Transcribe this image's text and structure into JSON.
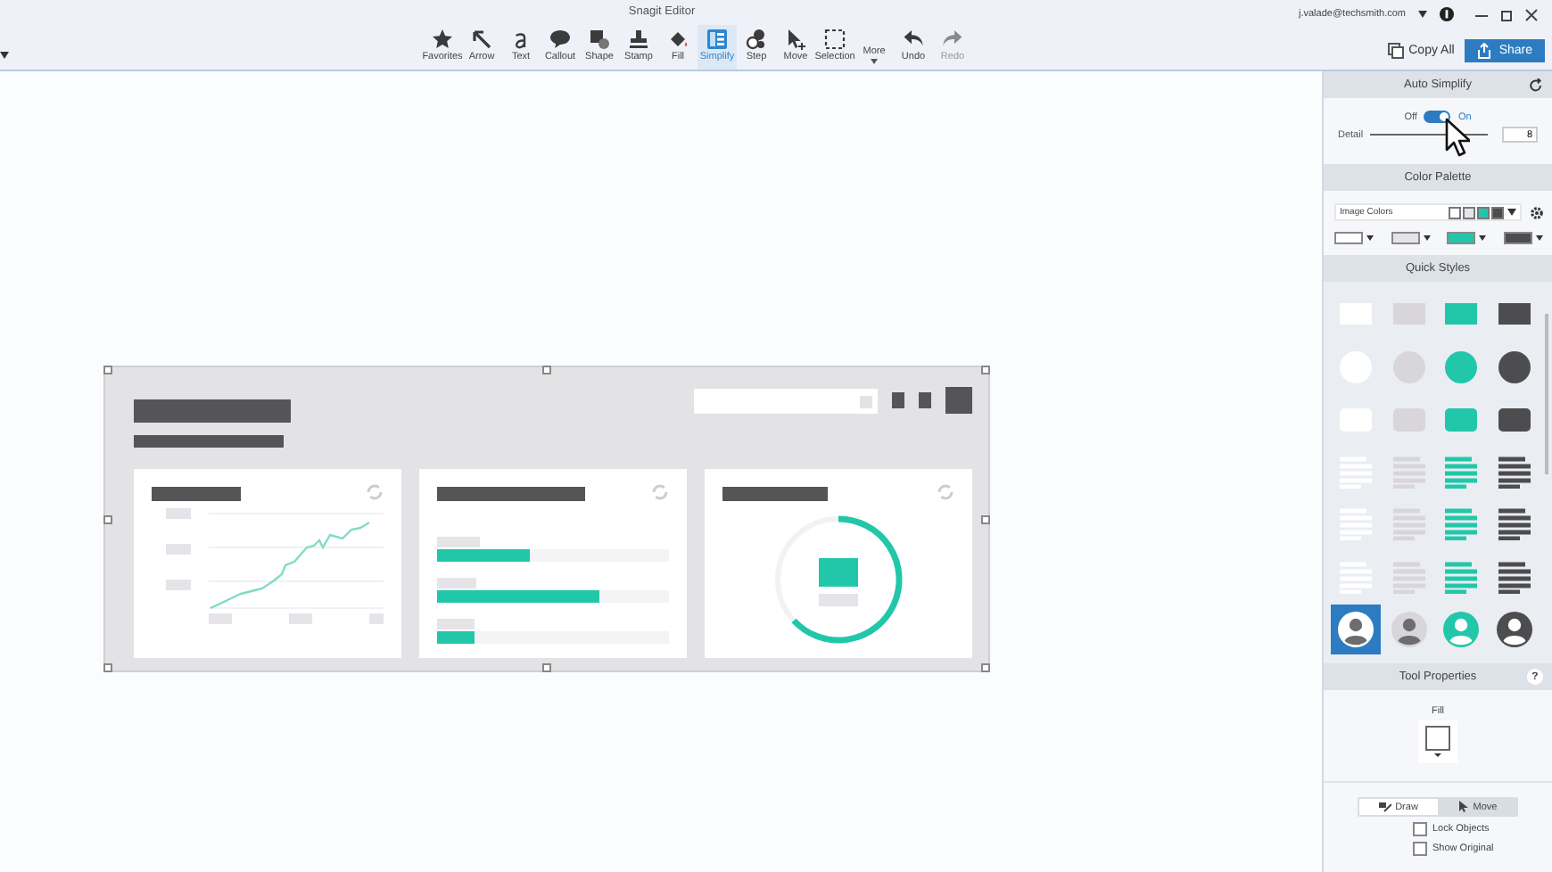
{
  "window": {
    "title": "Snagit Editor",
    "account": "j.valade@techsmith.com"
  },
  "toolbar": [
    {
      "label": "Favorites",
      "kind": "star",
      "selected": false,
      "disabled": false
    },
    {
      "label": "Arrow",
      "kind": "arrow",
      "selected": false,
      "disabled": false
    },
    {
      "label": "Text",
      "kind": "text",
      "selected": false,
      "disabled": false
    },
    {
      "label": "Callout",
      "kind": "callout",
      "selected": false,
      "disabled": false
    },
    {
      "label": "Shape",
      "kind": "shape",
      "selected": false,
      "disabled": false
    },
    {
      "label": "Stamp",
      "kind": "stamp",
      "selected": false,
      "disabled": false
    },
    {
      "label": "Fill",
      "kind": "fill",
      "selected": false,
      "disabled": false
    },
    {
      "label": "Simplify",
      "kind": "simplify",
      "selected": true,
      "disabled": false
    },
    {
      "label": "Step",
      "kind": "step",
      "selected": false,
      "disabled": false
    },
    {
      "label": "Move",
      "kind": "move",
      "selected": false,
      "disabled": false
    },
    {
      "label": "Selection",
      "kind": "selection",
      "selected": false,
      "disabled": false
    },
    {
      "label": "More",
      "kind": "more",
      "selected": false,
      "disabled": false
    },
    {
      "label": "Undo",
      "kind": "undo",
      "selected": false,
      "disabled": false
    },
    {
      "label": "Redo",
      "kind": "redo",
      "selected": false,
      "disabled": true
    }
  ],
  "actions": {
    "copy_all": "Copy All",
    "share": "Share"
  },
  "auto_simplify": {
    "title": "Auto Simplify",
    "off_label": "Off",
    "on_label": "On",
    "on": true,
    "detail_label": "Detail",
    "detail_value": "8"
  },
  "color_palette": {
    "title": "Color Palette",
    "palette": "Image Colors",
    "swatches": [
      {
        "color": "#ffffff"
      },
      {
        "color": "#e6e4e8"
      },
      {
        "color": "#22c7a9"
      },
      {
        "color": "#4d4d50"
      }
    ],
    "colors": [
      {
        "color": "#ffffff"
      },
      {
        "color": "#e6e4e8"
      },
      {
        "color": "#22c7a9"
      },
      {
        "color": "#4d4d50"
      }
    ]
  },
  "quick_styles": {
    "title": "Quick Styles",
    "rows": [
      {
        "kind": "rect",
        "items": [
          {
            "color": "#ffffff",
            "selected": false
          },
          {
            "color": "#d8d6db",
            "selected": false
          },
          {
            "color": "#22c7a9",
            "selected": false
          },
          {
            "color": "#4d4d50",
            "selected": false
          }
        ]
      },
      {
        "kind": "circle",
        "items": [
          {
            "color": "#ffffff",
            "selected": false
          },
          {
            "color": "#d8d6db",
            "selected": false
          },
          {
            "color": "#22c7a9",
            "selected": false
          },
          {
            "color": "#4d4d50",
            "selected": false
          }
        ]
      },
      {
        "kind": "rounded",
        "items": [
          {
            "color": "#ffffff",
            "selected": false
          },
          {
            "color": "#d8d6db",
            "selected": false
          },
          {
            "color": "#22c7a9",
            "selected": false
          },
          {
            "color": "#4d4d50",
            "selected": false
          }
        ]
      },
      {
        "kind": "lines",
        "items": [
          {
            "color": "#ffffff",
            "selected": false
          },
          {
            "color": "#d8d6db",
            "selected": false
          },
          {
            "color": "#22c7a9",
            "selected": false
          },
          {
            "color": "#4d4d50",
            "selected": false
          }
        ]
      },
      {
        "kind": "lines",
        "items": [
          {
            "color": "#ffffff",
            "selected": false
          },
          {
            "color": "#d8d6db",
            "selected": false
          },
          {
            "color": "#22c7a9",
            "selected": false
          },
          {
            "color": "#4d4d50",
            "selected": false
          }
        ]
      },
      {
        "kind": "lines",
        "items": [
          {
            "color": "#ffffff",
            "selected": false
          },
          {
            "color": "#d8d6db",
            "selected": false
          },
          {
            "color": "#22c7a9",
            "selected": false
          },
          {
            "color": "#4d4d50",
            "selected": false
          }
        ]
      },
      {
        "kind": "avatar",
        "items": [
          {
            "color": "#ffffff",
            "selected": true
          },
          {
            "color": "#d8d6db",
            "selected": false
          },
          {
            "color": "#22c7a9",
            "selected": false
          },
          {
            "color": "#4d4d50",
            "selected": false
          }
        ]
      }
    ]
  },
  "tool_properties": {
    "title": "Tool Properties",
    "help": "?",
    "fill_label": "Fill",
    "modes": [
      {
        "label": "Draw",
        "selected": true
      },
      {
        "label": "Move",
        "selected": false
      }
    ],
    "options": [
      {
        "label": "Lock Objects",
        "checked": false
      },
      {
        "label": "Show Original",
        "checked": false
      }
    ]
  }
}
